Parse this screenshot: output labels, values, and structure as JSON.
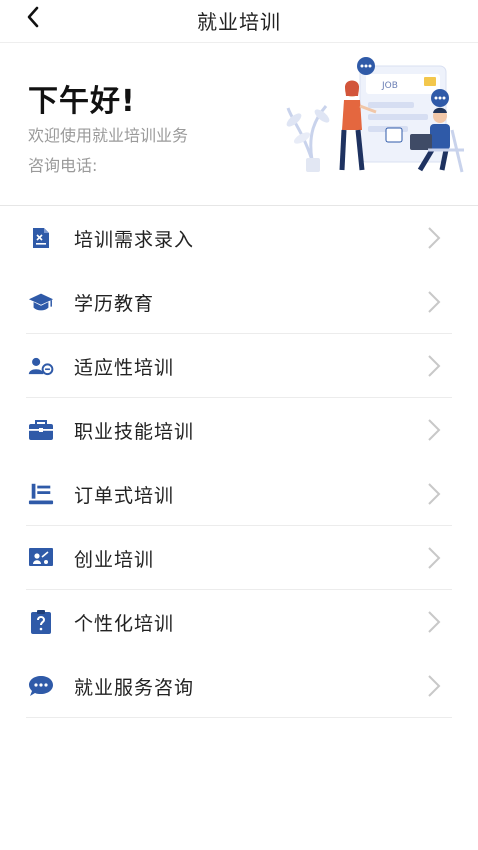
{
  "navbar": {
    "title": "就业培训",
    "back_icon": "chevron-left-icon"
  },
  "hero": {
    "greeting": "下午好!",
    "welcome": "欢迎使用就业培训业务",
    "phone_label": "咨询电话:",
    "illustration_text": "JOB"
  },
  "menu": {
    "items": [
      {
        "label": "培训需求录入",
        "icon": "document-icon"
      },
      {
        "label": "学历教育",
        "icon": "graduation-cap-icon"
      },
      {
        "label": "适应性培训",
        "icon": "user-shield-icon"
      },
      {
        "label": "职业技能培训",
        "icon": "briefcase-icon"
      },
      {
        "label": "订单式培训",
        "icon": "order-list-icon"
      },
      {
        "label": "创业培训",
        "icon": "presentation-icon"
      },
      {
        "label": "个性化培训",
        "icon": "question-clipboard-icon"
      },
      {
        "label": "就业服务咨询",
        "icon": "chat-bubble-icon"
      }
    ]
  },
  "colors": {
    "accent": "#2f5aa8",
    "text": "#222222",
    "muted": "#9a9a9a",
    "chevron": "#c8c8c8"
  }
}
